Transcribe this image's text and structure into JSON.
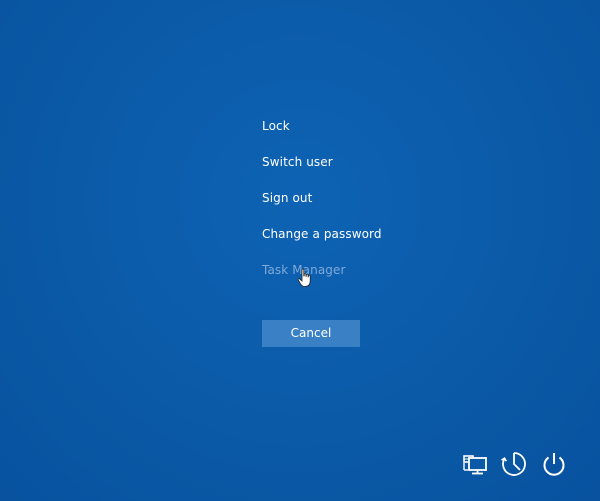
{
  "menu": {
    "items": [
      {
        "label": "Lock"
      },
      {
        "label": "Switch user"
      },
      {
        "label": "Sign out"
      },
      {
        "label": "Change a password"
      },
      {
        "label": "Task Manager"
      }
    ]
  },
  "cancel_label": "Cancel",
  "tray": {
    "icons": [
      "network-icon",
      "ease-of-access-icon",
      "power-icon"
    ]
  },
  "colors": {
    "background": "#0a5aa8",
    "button": "#3a80c4",
    "text": "#ffffff",
    "hover_text": "#7fa9d8"
  }
}
